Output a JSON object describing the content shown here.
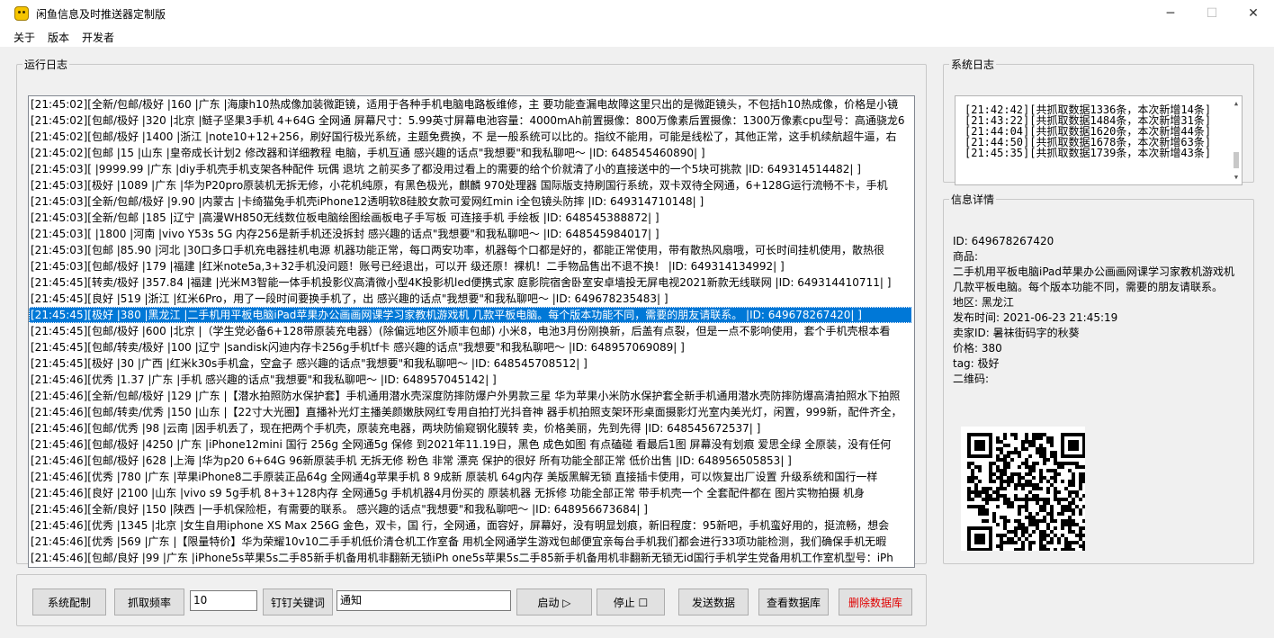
{
  "window": {
    "title": "闲鱼信息及时推送器定制版",
    "minimize": "─",
    "maximize": "☐",
    "close": "✕"
  },
  "menu": [
    "关于",
    "版本",
    "开发者"
  ],
  "log_panel": {
    "title": "运行日志",
    "lines": [
      "[21:45:02][全新/包邮/极好   |160     |广东     |海康h10热成像加装微距镜，适用于各种手机电脑电路板维修，主 要功能查漏电故障这里只出的是微距镜头，不包括h10热成像，价格是小镜",
      "[21:45:02][包邮/极好       |320     |北京     |鲢子坚果3手机 4+64G 全网通 屏幕尺寸：5.99英寸屏幕电池容量：4000mAh前置摄像：800万像素后置摄像：1300万像素cpu型号：高通骁龙6",
      "[21:45:02][包邮/极好       |1400    |浙江     |note10+12+256，刷好国行极光系统，主题免费换，不 是一般系统可以比的。指纹不能用，可能是线松了，其他正常，这手机续航超牛逼，右",
      "[21:45:02][包邮         |15      |山东     |皇帝成长计划2 修改器和详细教程 电脑，手机互通 感兴趣的话点\"我想要\"和我私聊吧～ |ID: 648545460890| ]",
      "[21:45:03][            |9999.99  |广东     |diy手机壳手机支架各种配件 玩偶 退坑 之前买多了都没用过看上的需要的给个价就清了小的直接送中的一个5块可挑款 |ID: 649314514482| ]",
      "[21:45:03][极好         |1089    |广东     |华为P20pro原装机无拆无修，小花机纯原，有黑色极光，麒麟 970处理器 国际版支持刷国行系统，双卡双待全网通，6+128G运行流畅不卡，手机",
      "[21:45:03][全新/包邮/极好   |9.90    |内蒙古   |卡绮猫兔手机壳iPhone12透明软8硅胶女款可爱网红min i全包镜头防摔 |ID: 649314710148| ]",
      "[21:45:03][全新/包邮       |185     |辽宁     |高漫WH850无线数位板电脑绘图绘画板电子手写板 可连接手机 手绘板 |ID: 648545388872| ]",
      "[21:45:03][            |1800    |河南     |vivo Y53s 5G   内存256是新手机还没拆封 感兴趣的话点\"我想要\"和我私聊吧～ |ID: 648545984017| ]",
      "[21:45:03][包邮         |85.90   |河北     |30口多口手机充电器挂机电源 机器功能正常，每口两安功率，机器每个口都是好的，都能正常使用，带有散热风扇哦，可长时间挂机使用，散热很",
      "[21:45:03][包邮/极好       |179     |福建     |红米note5a,3+32手机没问题！账号已经退出，可以开 级还原！裸机！二手物品售出不退不换！ |ID: 649314134992| ]",
      "[21:45:45][转卖/极好       |357.84  |福建     |光米M3智能一体手机投影仪高清微小型4K投影机led便携式家 庭影院宿舍卧室安卓墙投无屏电视2021新款无线联网 |ID: 649314410711| ]",
      "[21:45:45][良好         |519     |浙江     |红米6Pro，用了一段时间要换手机了，出 感兴趣的话点\"我想要\"和我私聊吧～ |ID: 649678235483| ]",
      "[21:45:45][极好         |380     |黑龙江   |二手机用平板电脑iPad苹果办公画画网课学习家教机游戏机 几款平板电脑。每个版本功能不同，需要的朋友请联系。 |ID: 649678267420| ]",
      "[21:45:45][包邮/极好       |600     |北京     |（学生党必备6+128带原装充电器）(除偏远地区外顺丰包邮) 小米8，电池3月份刚换新，后盖有点裂，但是一点不影响使用，套个手机壳根本看",
      "[21:45:45][包邮/转卖/极好   |100     |辽宁     |sandisk闪迪内存卡256g手机tf卡 感兴趣的话点\"我想要\"和我私聊吧～ |ID: 648957069089| ]",
      "[21:45:45][极好         |30      |广西     |红米k30s手机盒，空盒子 感兴趣的话点\"我想要\"和我私聊吧～ |ID: 648545708512| ]",
      "[21:45:46][优秀         |1.37    |广东     |手机 感兴趣的话点\"我想要\"和我私聊吧～ |ID: 648957045142| ]",
      "[21:45:46][全新/包邮/极好   |129     |广东     |【潜水拍照防水保护套】手机通用潜水壳深度防摔防爆户外男款三星 华为苹果小米防水保护套全新手机通用潜水壳防摔防爆高清拍照水下拍照",
      "[21:45:46][包邮/转卖/优秀   |150     |山东     |【22寸大光圈】直播补光灯主播美颜嫩肤网红专用自拍打光抖音神 器手机拍照支架环形桌面摄影灯光室内美光灯，闲置，999新，配件齐全，",
      "[21:45:46][包邮/优秀       |98      |云南     |因手机丢了，现在把两个手机壳，原装充电器，两块防偷窥钢化膜转 卖，价格美丽，先到先得 |ID: 648545672537| ]",
      "[21:45:46][包邮/极好       |4250    |广东     |iPhone12mini 国行 256g 全网通5g 保修 到2021年11.19日，黑色 成色如图 有点磕碰 看最后1图 屏幕没有划痕 爱思全绿  全原装，没有任何",
      "[21:45:46][包邮/极好       |628     |上海     |华为p20 6+64G 96新原装手机 无拆无修 粉色 非常 漂亮  保护的很好 所有功能全部正常 低价出售 |ID: 648956505853| ]",
      "[21:45:46][优秀         |780     |广东     |苹果iPhone8二手原装正品64g 全网通4g苹果手机 8 9成新 原装机 64g内存 美版黑解无锁 直接插卡使用，可以恢复出厂设置 升级系统和国行一样",
      "[21:45:46][良好         |2100    |山东     |vivo s9  5g手机  8+3+128内存 全网通5g 手机机器4月份买的    原装机器 无拆修 功能全部正常  带手机壳一个 全套配件都在  图片实物拍摄 机身",
      "[21:45:46][全新/良好       |150     |陕西     |一手机保险柜，有需要的联系。 感兴趣的话点\"我想要\"和我私聊吧～ |ID: 648956673684| ]",
      "[21:45:46][优秀         |1345    |北京     |女生自用iphone XS Max 256G 金色，双卡，国 行，全网通，面容好，屏幕好，没有明显划痕，新旧程度：95新吧，手机蛮好用的，挺流畅，想会",
      "[21:45:46][优秀         |569     |广东     |【限量特价】华为荣耀10v10二手手机低价清仓机工作室备 用机全网通学生游戏包邮便宜亲每台手机我们都会进行33项功能检测，我们确保手机无暇",
      "[21:45:46][包邮/良好       |99      |广东     |iPhone5s苹果5s二手85新手机备用机非翻新无锁iPh one5s苹果5s二手85新手机备用机非翻新无锁无id国行手机学生党备用机工作室机型号：iPh"
    ],
    "selected_index": 13
  },
  "system_log": {
    "title": "系统日志",
    "lines": [
      "[21:42:42][共抓取数据1336条，本次新增14条]",
      "[21:43:22][共抓取数据1484条，本次新增31条]",
      "[21:44:04][共抓取数据1620条，本次新增44条]",
      "[21:44:50][共抓取数据1678条，本次新增63条]",
      "[21:45:35][共抓取数据1739条，本次新增43条]"
    ]
  },
  "info": {
    "title": "信息详情",
    "id": "ID: 649678267420",
    "goods_label": "商品:",
    "goods": "二手机用平板电脑iPad苹果办公画画网课学习家教机游戏机几款平板电脑。每个版本功能不同，需要的朋友请联系。",
    "region": "地区: 黑龙江",
    "publish_time": "发布时间: 2021-06-23 21:45:19",
    "seller": "卖家ID: 暑袜街码字的秋葵",
    "price": "价格: 380",
    "tag": "tag: 极好",
    "qrcode_label": "二维码:"
  },
  "controls": {
    "config_button": "系统配制",
    "frequency_button": "抓取频率",
    "frequency_value": "10",
    "dingding_button": "钉钉关键词",
    "keyword_value": "通知",
    "start_button": "启动 ▷",
    "stop_button": "停止 ☐",
    "send_button": "发送数据",
    "view_db_button": "查看数据库",
    "delete_db_button": "删除数据库",
    "danger_color": "#e00000",
    "selection_color": "#0078d7"
  }
}
